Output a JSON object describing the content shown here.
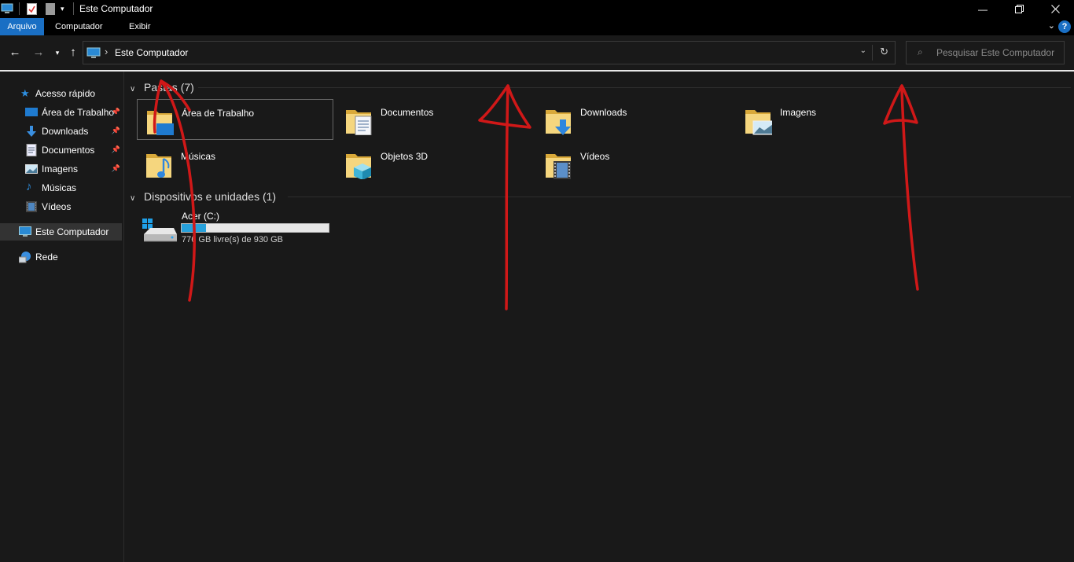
{
  "window": {
    "title": "Este Computador"
  },
  "ribbon": {
    "tabs": [
      {
        "label": "Arquivo",
        "active": true
      },
      {
        "label": "Computador",
        "active": false
      },
      {
        "label": "Exibir",
        "active": false
      }
    ],
    "help": "?"
  },
  "address": {
    "path": "Este Computador"
  },
  "search": {
    "placeholder": "Pesquisar Este Computador"
  },
  "sidebar": {
    "quick_access": "Acesso rápido",
    "items": [
      {
        "label": "Área de Trabalho",
        "pinned": true,
        "icon": "desktop-icon"
      },
      {
        "label": "Downloads",
        "pinned": true,
        "icon": "download-icon"
      },
      {
        "label": "Documentos",
        "pinned": true,
        "icon": "document-icon"
      },
      {
        "label": "Imagens",
        "pinned": true,
        "icon": "image-icon"
      },
      {
        "label": "Músicas",
        "pinned": false,
        "icon": "music-icon"
      },
      {
        "label": "Vídeos",
        "pinned": false,
        "icon": "video-icon"
      }
    ],
    "this_pc": "Este Computador",
    "network": "Rede"
  },
  "folders_group": {
    "title": "Pastas (7)"
  },
  "folders": [
    {
      "name": "Área de Trabalho",
      "overlay": "desktop"
    },
    {
      "name": "Documentos",
      "overlay": "document"
    },
    {
      "name": "Downloads",
      "overlay": "download"
    },
    {
      "name": "Imagens",
      "overlay": "image"
    },
    {
      "name": "Músicas",
      "overlay": "music"
    },
    {
      "name": "Objetos 3D",
      "overlay": "cube"
    },
    {
      "name": "Vídeos",
      "overlay": "video"
    }
  ],
  "devices_group": {
    "title": "Dispositivos e unidades (1)"
  },
  "drive": {
    "name": "Acer (C:)",
    "free_text": "776 GB livre(s) de 930 GB",
    "used_fraction": 0.166
  },
  "colors": {
    "accent": "#1a6fc4",
    "annotation": "#d01818",
    "drive_fill": "#26a0da"
  }
}
